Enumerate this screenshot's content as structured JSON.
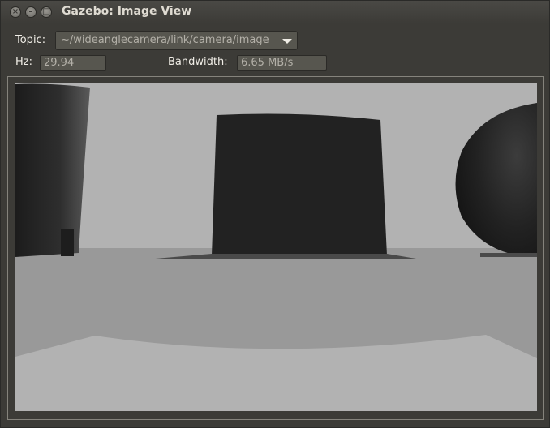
{
  "window": {
    "title": "Gazebo: Image View",
    "buttons": {
      "close": "close-icon",
      "minimize": "minimize-icon",
      "maximize": "maximize-icon"
    }
  },
  "controls": {
    "topic_label": "Topic:",
    "topic_value": "~/wideanglecamera/link/camera/image",
    "hz_label": "Hz:",
    "hz_value": "29.94",
    "bandwidth_label": "Bandwidth:",
    "bandwidth_value": "6.65 MB/s"
  },
  "colors": {
    "window_bg": "#3c3b37",
    "field_bg": "#57564f",
    "sky": "#b2b2b2",
    "ground": "#999999",
    "object_dark": "#212121"
  }
}
